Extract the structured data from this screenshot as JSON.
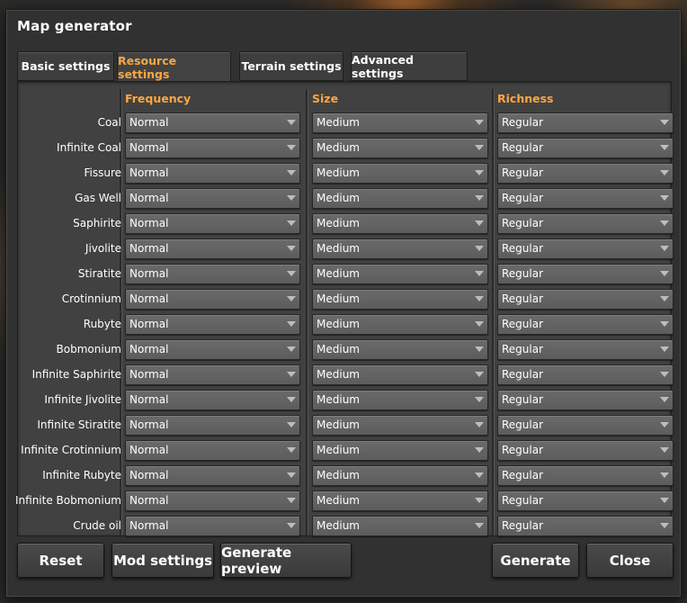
{
  "window": {
    "title": "Map generator"
  },
  "tabs": [
    {
      "label": "Basic settings",
      "active": false
    },
    {
      "label": "Resource settings",
      "active": true
    },
    {
      "label": "Terrain settings",
      "active": false
    },
    {
      "label": "Advanced settings",
      "active": false
    }
  ],
  "columns": {
    "frequency": "Frequency",
    "size": "Size",
    "richness": "Richness"
  },
  "resources": [
    {
      "name": "Coal",
      "frequency": "Normal",
      "size": "Medium",
      "richness": "Regular"
    },
    {
      "name": "Infinite Coal",
      "frequency": "Normal",
      "size": "Medium",
      "richness": "Regular"
    },
    {
      "name": "Fissure",
      "frequency": "Normal",
      "size": "Medium",
      "richness": "Regular"
    },
    {
      "name": "Gas Well",
      "frequency": "Normal",
      "size": "Medium",
      "richness": "Regular"
    },
    {
      "name": "Saphirite",
      "frequency": "Normal",
      "size": "Medium",
      "richness": "Regular"
    },
    {
      "name": "Jivolite",
      "frequency": "Normal",
      "size": "Medium",
      "richness": "Regular"
    },
    {
      "name": "Stiratite",
      "frequency": "Normal",
      "size": "Medium",
      "richness": "Regular"
    },
    {
      "name": "Crotinnium",
      "frequency": "Normal",
      "size": "Medium",
      "richness": "Regular"
    },
    {
      "name": "Rubyte",
      "frequency": "Normal",
      "size": "Medium",
      "richness": "Regular"
    },
    {
      "name": "Bobmonium",
      "frequency": "Normal",
      "size": "Medium",
      "richness": "Regular"
    },
    {
      "name": "Infinite Saphirite",
      "frequency": "Normal",
      "size": "Medium",
      "richness": "Regular"
    },
    {
      "name": "Infinite Jivolite",
      "frequency": "Normal",
      "size": "Medium",
      "richness": "Regular"
    },
    {
      "name": "Infinite Stiratite",
      "frequency": "Normal",
      "size": "Medium",
      "richness": "Regular"
    },
    {
      "name": "Infinite Crotinnium",
      "frequency": "Normal",
      "size": "Medium",
      "richness": "Regular"
    },
    {
      "name": "Infinite Rubyte",
      "frequency": "Normal",
      "size": "Medium",
      "richness": "Regular"
    },
    {
      "name": "Infinite Bobmonium",
      "frequency": "Normal",
      "size": "Medium",
      "richness": "Regular"
    },
    {
      "name": "Crude oil",
      "frequency": "Normal",
      "size": "Medium",
      "richness": "Regular"
    }
  ],
  "buttons": {
    "reset": "Reset",
    "mod_settings": "Mod settings",
    "generate_preview": "Generate preview",
    "generate": "Generate",
    "close": "Close"
  },
  "colors": {
    "accent": "#ffa640",
    "panel": "#313131",
    "dropdown": "#626262"
  }
}
